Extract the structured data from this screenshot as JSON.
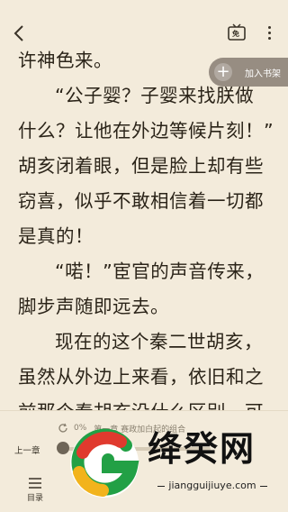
{
  "toolbar": {
    "back_icon": "chevron-left-icon",
    "free_badge_text": "免",
    "more_icon": "more-vertical-icon"
  },
  "shelf": {
    "plus": "+",
    "label": "加入书架"
  },
  "content": {
    "lines": [
      "许神色来。",
      "“公子婴？子婴来找朕做",
      "什么？让他在外边等候片刻！”",
      "胡亥闭着眼，但是脸上却有些",
      "窃喜，似乎不敢相信着一切都",
      "是真的！",
      "“喏！”宦官的声音传来，",
      "脚步声随即远去。",
      "现在的这个秦二世胡亥，",
      "虽然从外边上来看，依旧和之",
      "前那个秦胡亥没什么区别，可"
    ]
  },
  "bottom": {
    "progress_percent": "0%",
    "progress_fraction": 0.0,
    "chapter_title": "第一章  赛政加白起的组合",
    "prev_chapter": "上一章",
    "toc_label": "目录"
  },
  "watermark": {
    "title": "绛癸网",
    "url": "jiangguijiuye.com",
    "colors": {
      "red": "#e03a2e",
      "green": "#22a045",
      "yellow": "#f2b31c"
    }
  },
  "colors": {
    "page_background": "#f3ebdb",
    "text": "#2b2419"
  }
}
